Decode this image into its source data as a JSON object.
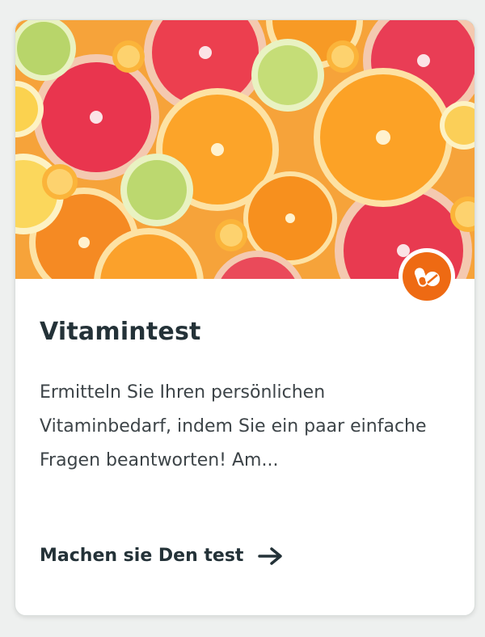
{
  "card": {
    "image_alt": "citrus-slices",
    "badge_icon": "pills-icon",
    "title": "Vitamintest",
    "description": "Ermitteln Sie Ihren persönlichen Vitaminbedarf, indem Sie ein paar einfache Fragen beantworten! Am...",
    "cta_label": "Machen sie Den test",
    "cta_icon": "arrow-right-icon"
  },
  "colors": {
    "accent": "#ee6a13",
    "title": "#243238",
    "text": "#3d4448"
  }
}
